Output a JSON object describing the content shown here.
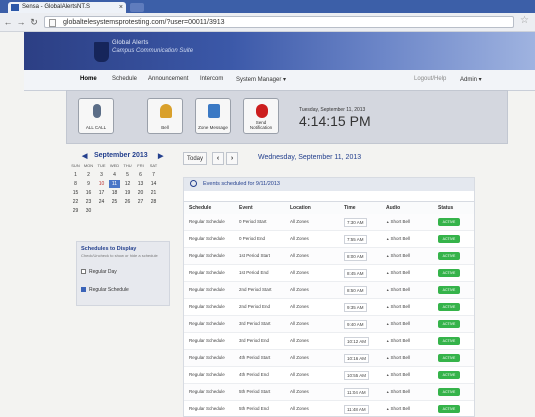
{
  "browser": {
    "tab_title": "Sensa - GlobalAlertsNT.S",
    "url": "globaltelesystemsprotesting.com/?user=00011/3913",
    "tab_close": "×"
  },
  "header": {
    "org_name": "Global Alerts",
    "org_sub": "Campus Communication Suite"
  },
  "nav": {
    "items": [
      "Home",
      "Schedule",
      "Announcement",
      "Intercom",
      "System Manager ▾"
    ],
    "right_link": "Logout/Help",
    "user": "Admin ▾"
  },
  "actions": [
    {
      "label": "ALL CALL",
      "color": "#5b6d87"
    },
    {
      "label": "Bell",
      "color": "#d9a02b"
    },
    {
      "label": "Zone Message",
      "color": "#3b79c4"
    },
    {
      "label": "Send Notification",
      "color": "#cc1e1e"
    }
  ],
  "datetime": {
    "date": "Tuesday, September 11, 2013",
    "time": "4:14:15 PM"
  },
  "calendar": {
    "prev": "◀",
    "title": "September 2013",
    "next": "▶",
    "dows": [
      "SUN",
      "MON",
      "TUE",
      "WED",
      "THU",
      "FRI",
      "SAT"
    ],
    "weeks": [
      [
        "1",
        "2",
        "3",
        "4",
        "5",
        "6",
        "7"
      ],
      [
        "8",
        "9",
        "10",
        "11",
        "12",
        "13",
        "14"
      ],
      [
        "15",
        "16",
        "17",
        "18",
        "19",
        "20",
        "21"
      ],
      [
        "22",
        "23",
        "24",
        "25",
        "26",
        "27",
        "28"
      ],
      [
        "29",
        "30",
        "",
        "",
        "",
        "",
        ""
      ]
    ],
    "today": "11"
  },
  "schedules_panel": {
    "title": "Schedules to Display",
    "subtitle": "Check/Uncheck to show or hide a schedule",
    "items": [
      {
        "label": "Regular Day",
        "checked": false
      },
      {
        "label": "Regular Schedule",
        "checked": true
      }
    ]
  },
  "table_toolbar": {
    "today": "Today",
    "prev": "‹",
    "next": "›",
    "current_date": "Wednesday, September 11, 2013"
  },
  "events": {
    "title": "Events scheduled for 9/11/2013",
    "columns": [
      "Schedule",
      "Event",
      "Location",
      "Time",
      "Audio",
      "Status"
    ],
    "rows": [
      [
        "Regular Schedule",
        "0 Period Start",
        "All Zones",
        "7:30 AM",
        "Short Bell",
        "ACTIVE"
      ],
      [
        "Regular Schedule",
        "0 Period End",
        "All Zones",
        "7:55 AM",
        "Short Bell",
        "ACTIVE"
      ],
      [
        "Regular Schedule",
        "1st Period Start",
        "All Zones",
        "8:00 AM",
        "Short Bell",
        "ACTIVE"
      ],
      [
        "Regular Schedule",
        "1st Period End",
        "All Zones",
        "8:45 AM",
        "Short Bell",
        "ACTIVE"
      ],
      [
        "Regular Schedule",
        "2nd Period Start",
        "All Zones",
        "8:50 AM",
        "Short Bell",
        "ACTIVE"
      ],
      [
        "Regular Schedule",
        "2nd Period End",
        "All Zones",
        "9:35 AM",
        "Short Bell",
        "ACTIVE"
      ],
      [
        "Regular Schedule",
        "3rd Period Start",
        "All Zones",
        "9:40 AM",
        "Short Bell",
        "ACTIVE"
      ],
      [
        "Regular Schedule",
        "3rd Period End",
        "All Zones",
        "10:12 AM",
        "Short Bell",
        "ACTIVE"
      ],
      [
        "Regular Schedule",
        "4th Period Start",
        "All Zones",
        "10:16 AM",
        "Short Bell",
        "ACTIVE"
      ],
      [
        "Regular Schedule",
        "4th Period End",
        "All Zones",
        "10:55 AM",
        "Short Bell",
        "ACTIVE"
      ],
      [
        "Regular Schedule",
        "5th Period Start",
        "All Zones",
        "11:04 AM",
        "Short Bell",
        "ACTIVE"
      ],
      [
        "Regular Schedule",
        "5th Period End",
        "All Zones",
        "11:48 AM",
        "Short Bell",
        "ACTIVE"
      ]
    ]
  }
}
